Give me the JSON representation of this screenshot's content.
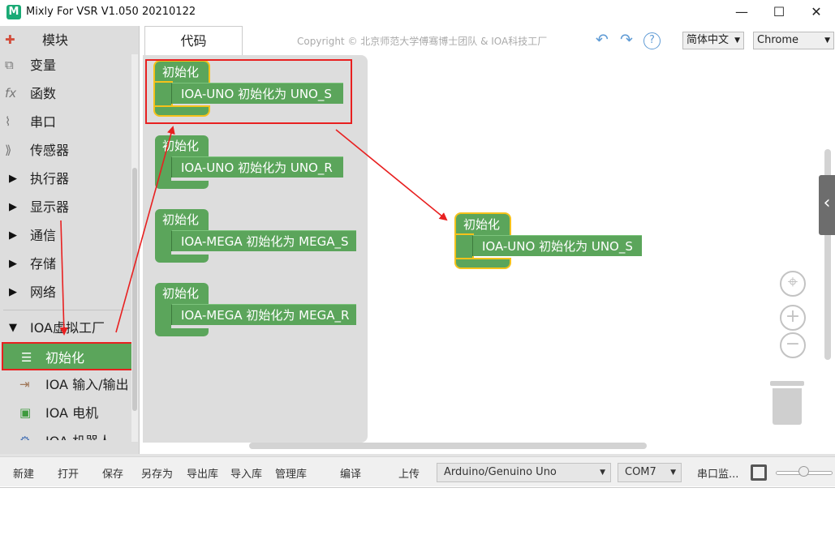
{
  "window": {
    "app_icon": "M",
    "title": "Mixly For VSR V1.050 20210122",
    "minimize": "—",
    "maximize": "☐",
    "close": "✕"
  },
  "sidebar": {
    "categories": [
      {
        "label": "模块",
        "icon": "puzzle-icon"
      },
      {
        "label": "变量",
        "icon": "variable-icon"
      },
      {
        "label": "函数",
        "icon": "function-icon"
      },
      {
        "label": "串口",
        "icon": "serial-icon"
      },
      {
        "label": "传感器",
        "icon": "sensor-icon"
      },
      {
        "label": "执行器",
        "icon": "expand-triangle"
      },
      {
        "label": "显示器",
        "icon": "expand-triangle"
      },
      {
        "label": "通信",
        "icon": "expand-triangle"
      },
      {
        "label": "存储",
        "icon": "expand-triangle"
      },
      {
        "label": "网络",
        "icon": "expand-triangle"
      },
      {
        "label": "IOA虚拟工厂",
        "icon": "collapse-triangle"
      },
      {
        "label": "初始化",
        "icon": "list-icon"
      },
      {
        "label": "IOA 输入/输出",
        "icon": "io-icon"
      },
      {
        "label": "IOA 电机",
        "icon": "motor-icon"
      },
      {
        "label": "IOA 机器人",
        "icon": "robot-icon"
      }
    ],
    "selected_index": 11
  },
  "top_toolbar": {
    "tab_code": "代码",
    "copyright": "Copyright © 北京师范大学傅骞博士团队 & IOA科技工厂",
    "undo": "↶",
    "redo": "↷",
    "help": "?",
    "language": "简体中文",
    "browser": "Chrome"
  },
  "flyout_blocks": [
    {
      "hat": "初始化",
      "stmt": "IOA-UNO   初始化为 UNO_S"
    },
    {
      "hat": "初始化",
      "stmt": "IOA-UNO   初始化为 UNO_R"
    },
    {
      "hat": "初始化",
      "stmt": "IOA-MEGA   初始化为 MEGA_S"
    },
    {
      "hat": "初始化",
      "stmt": "IOA-MEGA   初始化为 MEGA_R"
    }
  ],
  "workspace_block": {
    "hat": "初始化",
    "stmt": "IOA-UNO   初始化为 UNO_S"
  },
  "workspace_controls": {
    "recenter": "⌖",
    "zoom_in": "+",
    "zoom_out": "−",
    "side_tab": "‹"
  },
  "bottom_toolbar": {
    "new": "新建",
    "open": "打开",
    "save": "保存",
    "save_as": "另存为",
    "export_lib": "导出库",
    "import_lib": "导入库",
    "manage_lib": "管理库",
    "compile": "编译",
    "upload": "上传",
    "board": "Arduino/Genuino Uno",
    "port": "COM7",
    "serial_monitor": "串口监..."
  },
  "colors": {
    "block_green": "#5ba55b",
    "selection_yellow": "#f5c21b",
    "annotation_red": "#e82020",
    "toolbar_icon_blue": "#5f9bd5"
  }
}
